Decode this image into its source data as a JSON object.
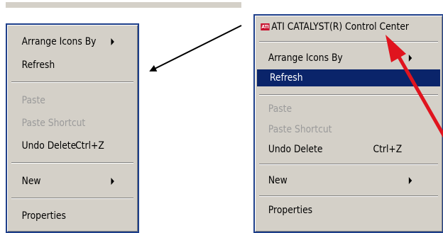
{
  "left_menu": {
    "items": [
      {
        "label": "Arrange Icons By"
      },
      {
        "label": "Refresh"
      },
      {
        "label": "Paste"
      },
      {
        "label": "Paste Shortcut"
      },
      {
        "label": "Undo Delete",
        "shortcut": "Ctrl+Z"
      },
      {
        "label": "New"
      },
      {
        "label": "Properties"
      }
    ]
  },
  "right_menu": {
    "ati_icon_text": "ATI",
    "items": [
      {
        "label": "ATI CATALYST(R) Control Center"
      },
      {
        "label": "Arrange Icons By"
      },
      {
        "label": "Refresh"
      },
      {
        "label": "Paste"
      },
      {
        "label": "Paste Shortcut"
      },
      {
        "label": "Undo Delete",
        "shortcut": "Ctrl+Z"
      },
      {
        "label": "New"
      },
      {
        "label": "Properties"
      }
    ]
  },
  "colors": {
    "menu_background": "#d4d0c8",
    "menu_border": "#1e3f8a",
    "highlight": "#0a246a",
    "disabled_text": "#9a9a9a",
    "ati_brand": "#c8102e",
    "annotation_black_arrow": "#000000",
    "annotation_red_arrow": "#e0141e"
  },
  "icons": {
    "submenu": "triangle-right",
    "ati_logo": "ati-logo-icon"
  }
}
